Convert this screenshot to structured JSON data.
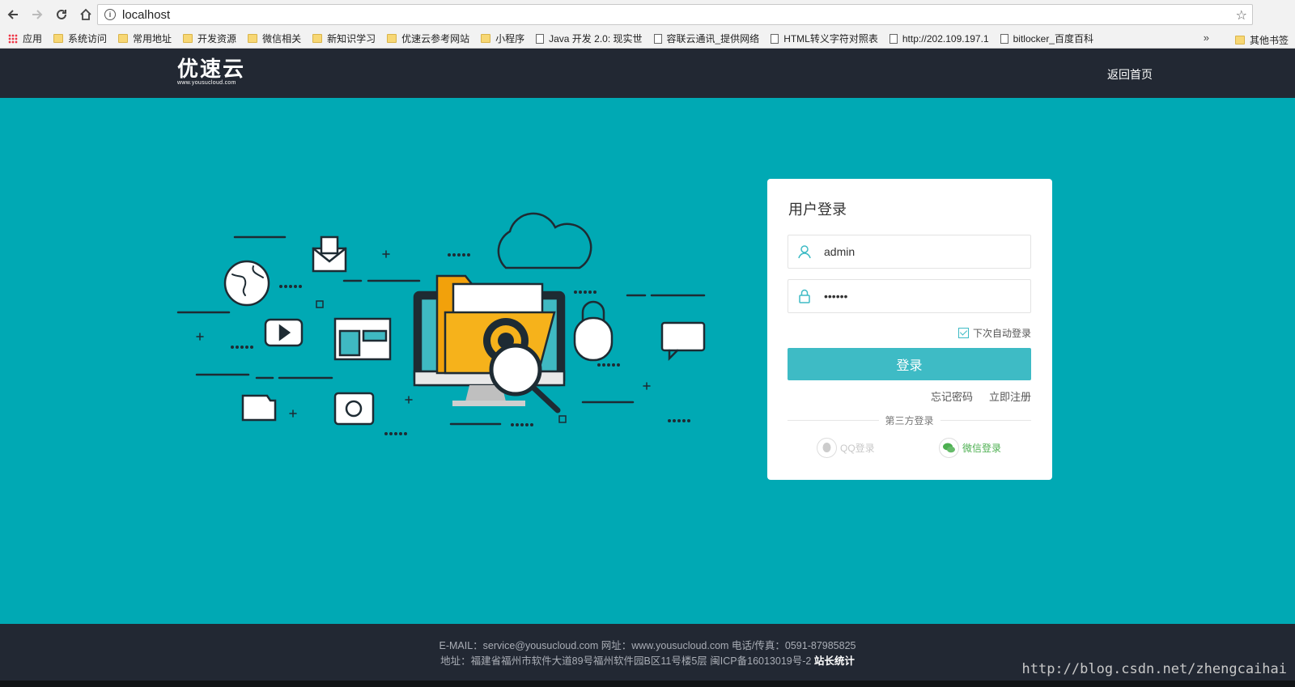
{
  "browser": {
    "url": "localhost",
    "bookmarks": [
      {
        "label": "应用",
        "icon": "apps-grid-icon"
      },
      {
        "label": "系统访问",
        "icon": "folder-icon"
      },
      {
        "label": "常用地址",
        "icon": "folder-icon"
      },
      {
        "label": "开发资源",
        "icon": "folder-icon"
      },
      {
        "label": "微信相关",
        "icon": "folder-icon"
      },
      {
        "label": "新知识学习",
        "icon": "folder-icon"
      },
      {
        "label": "优速云参考网站",
        "icon": "folder-icon"
      },
      {
        "label": "小程序",
        "icon": "folder-icon"
      },
      {
        "label": "Java 开发 2.0: 现实世",
        "icon": "page-icon"
      },
      {
        "label": "容联云通讯_提供网络",
        "icon": "page-icon"
      },
      {
        "label": "HTML转义字符对照表",
        "icon": "page-icon"
      },
      {
        "label": "http://202.109.197.1",
        "icon": "page-icon"
      },
      {
        "label": "bitlocker_百度百科",
        "icon": "page-icon"
      }
    ],
    "more": "»",
    "other_bookmarks": "其他书签"
  },
  "header": {
    "logo": "优速云",
    "logo_sub": "www.yousucloud.com",
    "home_link": "返回首页"
  },
  "login": {
    "title": "用户登录",
    "username": "admin",
    "password": "••••••",
    "remember": "下次自动登录",
    "submit": "登录",
    "forgot": "忘记密码",
    "register": "立即注册",
    "third_party": "第三方登录",
    "qq": "QQ登录",
    "wechat": "微信登录",
    "accent_color": "#3ebbc5"
  },
  "footer": {
    "line1": "E-MAIL：service@yousucloud.com    网址：www.yousucloud.com    电话/传真：0591-87985825",
    "line2": "地址：福建省福州市软件大道89号福州软件园B区11号楼5层    闽ICP备16013019号-2",
    "stats": "站长统计"
  },
  "watermark": "http://blog.csdn.net/zhengcaihai",
  "theme": {
    "header_bg": "#222833",
    "main_bg": "#00a9b4"
  }
}
